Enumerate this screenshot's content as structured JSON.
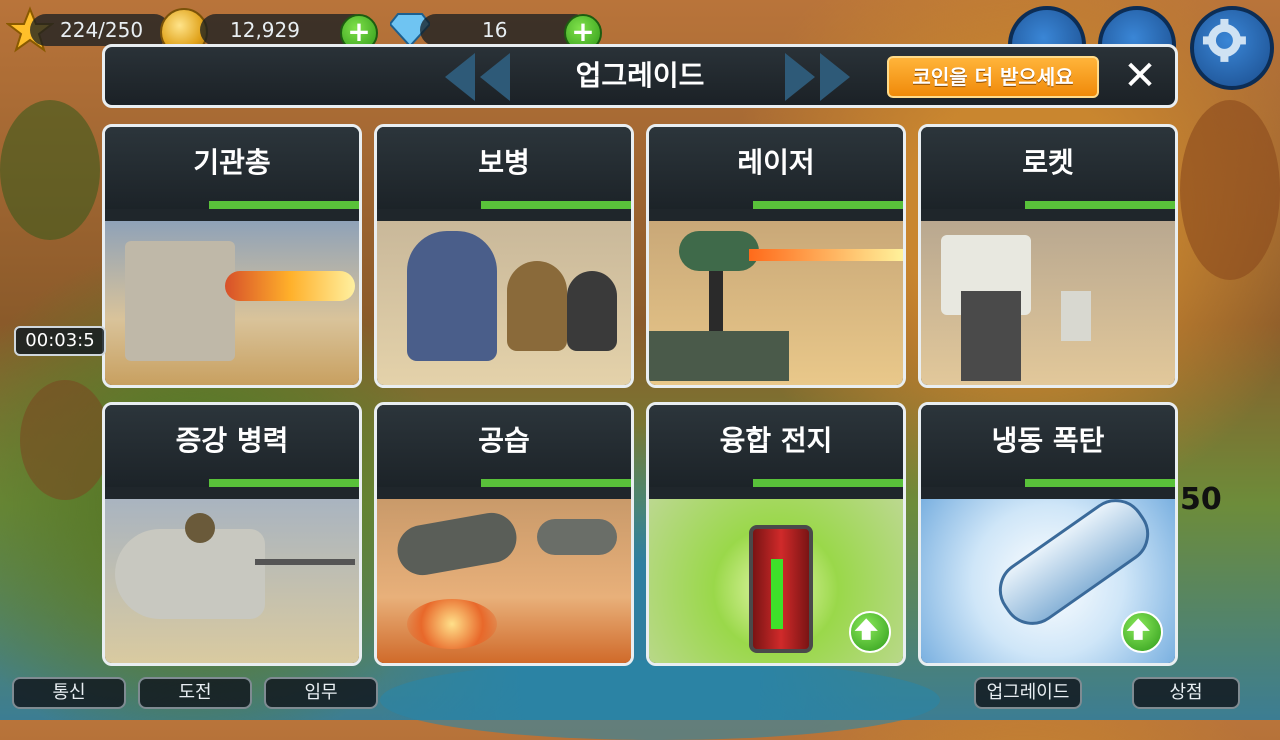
{
  "hud": {
    "stars": "224/250",
    "coins": "12,929",
    "gems": "16"
  },
  "header": {
    "title": "업그레이드",
    "more_coins_label": "코인을 더 받으세요",
    "close_label": "✕"
  },
  "cards": [
    {
      "name": "기관총",
      "has_upgrade": false
    },
    {
      "name": "보병",
      "has_upgrade": false
    },
    {
      "name": "레이저",
      "has_upgrade": false
    },
    {
      "name": "로켓",
      "has_upgrade": false
    },
    {
      "name": "증강 병력",
      "has_upgrade": false
    },
    {
      "name": "공습",
      "has_upgrade": false
    },
    {
      "name": "융합 전지",
      "has_upgrade": true
    },
    {
      "name": "냉동 폭탄",
      "has_upgrade": true
    }
  ],
  "side": {
    "timer": "00:03:5",
    "level": "50"
  },
  "bottom_tabs": {
    "comms": "통신",
    "challenge": "도전",
    "mission": "임무",
    "upgrade": "업그레이드",
    "shop": "상점"
  },
  "colors": {
    "accent_green": "#59c13a",
    "button_orange": "#f08a0a",
    "panel_dark": "#1c2328"
  }
}
